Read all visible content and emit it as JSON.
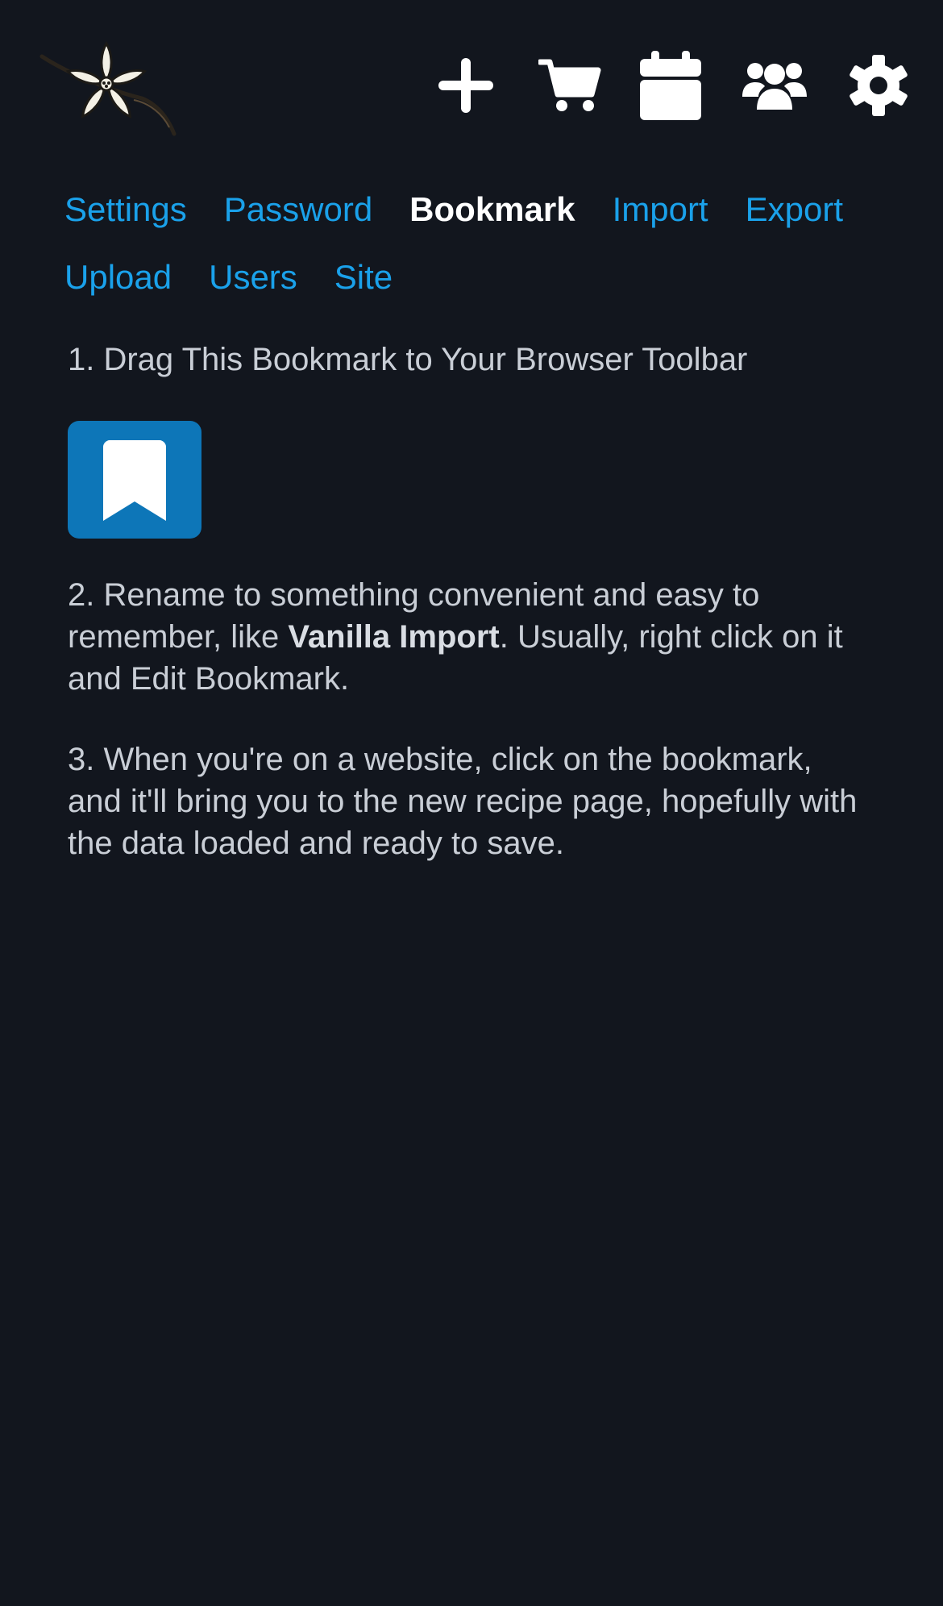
{
  "header": {
    "icons": [
      "add-icon",
      "cart-icon",
      "calendar-icon",
      "users-icon",
      "gear-icon"
    ],
    "logo": "vanilla-flower-logo"
  },
  "subnav": {
    "items": [
      {
        "label": "Settings",
        "active": false
      },
      {
        "label": "Password",
        "active": false
      },
      {
        "label": "Bookmark",
        "active": true
      },
      {
        "label": "Import",
        "active": false
      },
      {
        "label": "Export",
        "active": false
      },
      {
        "label": "Upload",
        "active": false
      },
      {
        "label": "Users",
        "active": false
      },
      {
        "label": "Site",
        "active": false
      }
    ]
  },
  "content": {
    "step1": "1. Drag This Bookmark to Your Browser Toolbar",
    "step2_pre": "2. Rename to something convenient and easy to remember, like ",
    "step2_bold": "Vanilla Import",
    "step2_post": ". Usually, right click on it and Edit Bookmark.",
    "step3": "3. When you're on a website, click on the bookmark, and it'll bring you to the new recipe page, hopefully with the data loaded and ready to save."
  },
  "colors": {
    "background": "#12161e",
    "link": "#1aa1ea",
    "active": "#ffffff",
    "text": "#c9ced6",
    "bookmark_button": "#0d76b8"
  }
}
